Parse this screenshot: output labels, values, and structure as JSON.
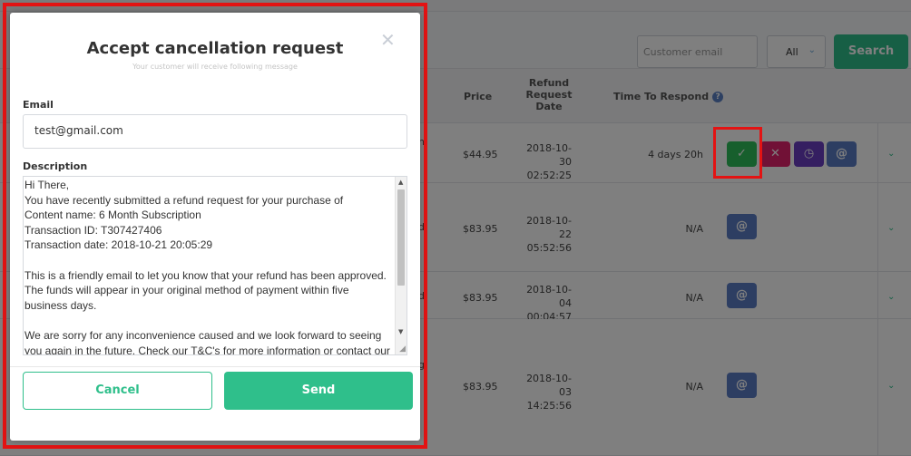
{
  "toolbar": {
    "email_placeholder": "Customer email",
    "filter_value": "All",
    "search_label": "Search"
  },
  "table": {
    "headers": {
      "price": "Price",
      "refund_line1": "Refund",
      "refund_line2": "Request",
      "refund_line3": "Date",
      "time_to_respond": "Time To Respond"
    },
    "rows": [
      {
        "left_fragment": "n",
        "price": "$44.95",
        "date": "2018-10-30",
        "time": "02:52:25",
        "respond": "4 days 20h"
      },
      {
        "left_fragment": "d",
        "price": "$83.95",
        "date": "2018-10-22",
        "time": "05:52:56",
        "respond": "N/A"
      },
      {
        "left_fragment": "d",
        "price": "$83.95",
        "date": "2018-10-04",
        "time": "00:04:57",
        "respond": "N/A"
      },
      {
        "left_fragment": "g",
        "price": "$83.95",
        "date": "2018-10-03",
        "time": "14:25:56",
        "respond": "N/A"
      }
    ]
  },
  "icons": {
    "help": "?",
    "check": "✓",
    "reject": "✕",
    "clock": "◷",
    "at": "@",
    "chevron": "⌄",
    "close": "✕"
  },
  "modal": {
    "title": "Accept cancellation request",
    "subtitle": "Your customer will receive following message",
    "email_label": "Email",
    "email_value": "test@gmail.com",
    "description_label": "Description",
    "description": "Hi There,\nYou have recently submitted a refund request for your purchase of\nContent name: 6 Month Subscription\nTransaction ID: T307427406\nTransaction date: 2018-10-21 20:05:29\n\nThis is a friendly email to let you know that your refund has been approved.\nThe funds will appear in your original method of payment within five business days.\n\nWe are sorry for any inconvenience caused and we look forward to seeing you again in the future. Check our T&C's for more information or contact our friendly",
    "cancel_label": "Cancel",
    "send_label": "Send"
  },
  "colors": {
    "accent": "#2fbf8b",
    "highlight": "#e31313",
    "approve": "#2fbf5b",
    "reject": "#e2236d",
    "schedule": "#6b3fc2",
    "email": "#5a7cc4"
  }
}
